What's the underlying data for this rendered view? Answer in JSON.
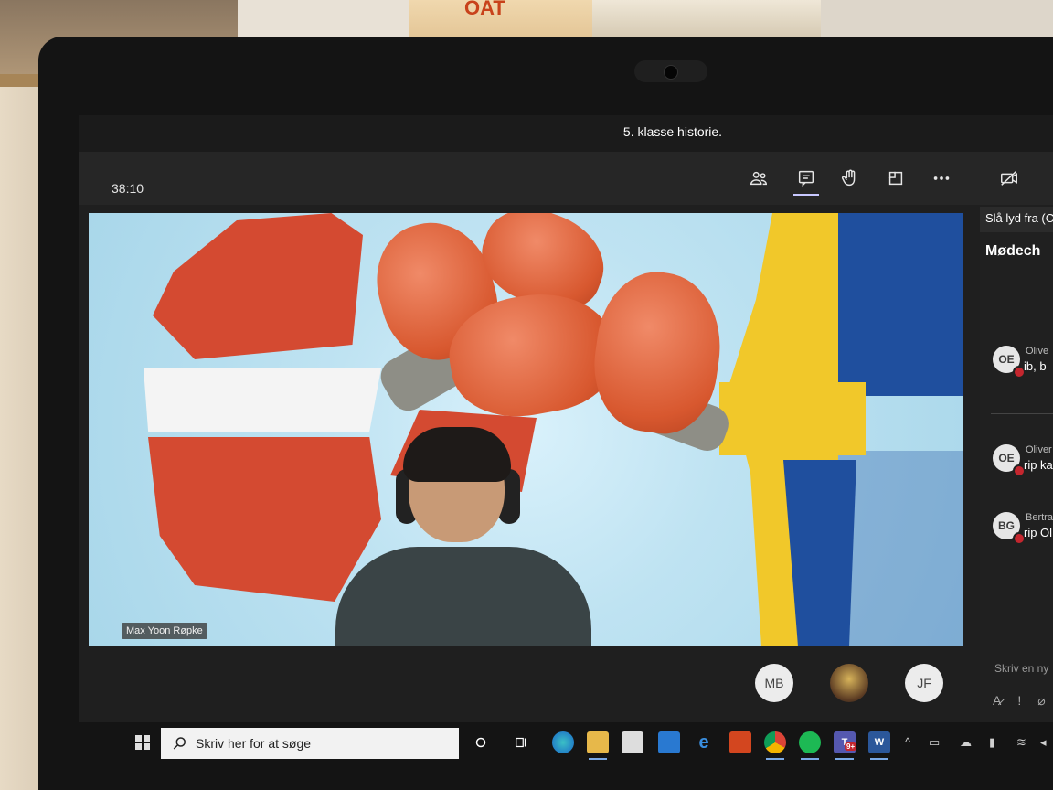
{
  "window": {
    "title": "5. klasse historie."
  },
  "meeting": {
    "timer": "38:10",
    "toolbar": [
      "participants-icon",
      "chat-icon",
      "raise-hand-icon",
      "share-tray-icon",
      "more-options-icon",
      "camera-off-icon"
    ],
    "tooltip": "Slå lyd fra (C"
  },
  "stage": {
    "presenter_name": "Max Yoon Røpke",
    "colors": {
      "denmark_red": "#d44a31",
      "sweden_blue": "#1f4f9e",
      "sweden_yellow": "#f1c82a",
      "glove": "#d8582f"
    }
  },
  "chat": {
    "panel_title": "Mødech",
    "messages": [
      {
        "initials": "OE",
        "sender": "Olive",
        "text": "ib, b"
      },
      {
        "initials": "OE",
        "sender": "Oliver",
        "text": "rip ka"
      },
      {
        "initials": "BG",
        "sender": "Bertran",
        "text": "rip Ol"
      }
    ],
    "compose_placeholder": "Skriv en ny",
    "compose_tools": [
      "format-icon",
      "important-icon",
      "attach-icon"
    ]
  },
  "roster": [
    {
      "initials": "MB"
    },
    {
      "initials": ""
    },
    {
      "initials": "JF"
    }
  ],
  "taskbar": {
    "search_placeholder": "Skriv her for at søge",
    "apps": [
      "cortana",
      "task-view",
      "edge",
      "file-explorer",
      "store",
      "mail",
      "internet-explorer",
      "office",
      "chrome",
      "spotify",
      "teams",
      "word"
    ],
    "teams_badge": "9+",
    "word_label": "W",
    "teams_label": "T"
  }
}
